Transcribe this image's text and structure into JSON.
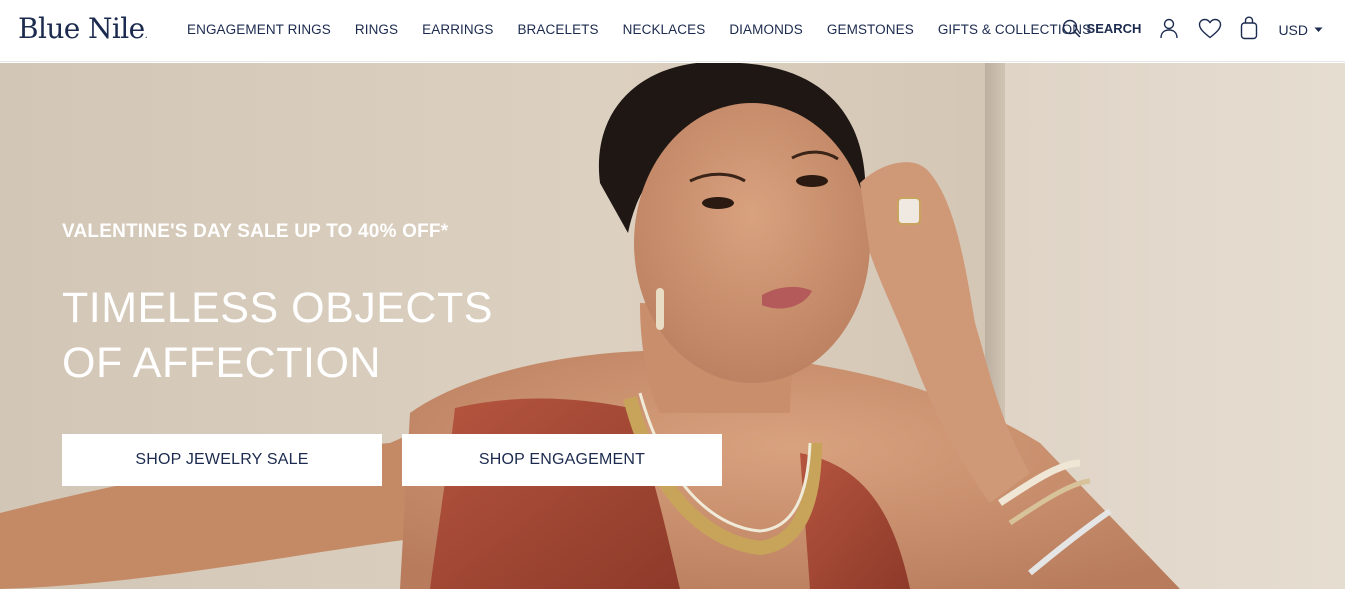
{
  "brand": {
    "logo_text": "Blue Nile",
    "logo_dot": "."
  },
  "nav": {
    "items": [
      {
        "label": "ENGAGEMENT RINGS"
      },
      {
        "label": "RINGS"
      },
      {
        "label": "EARRINGS"
      },
      {
        "label": "BRACELETS"
      },
      {
        "label": "NECKLACES"
      },
      {
        "label": "DIAMONDS"
      },
      {
        "label": "GEMSTONES"
      },
      {
        "label": "GIFTS & COLLECTIONS"
      }
    ]
  },
  "tools": {
    "search_label": "SEARCH",
    "search_icon": "search-icon",
    "account_icon": "person-icon",
    "wishlist_icon": "heart-icon",
    "bag_icon": "bag-icon",
    "currency": "USD",
    "currency_icon": "caret-down-icon"
  },
  "hero": {
    "promo": "VALENTINE'S DAY SALE UP TO 40% OFF*",
    "headline_line1": "TIMELESS OBJECTS",
    "headline_line2": "OF AFFECTION",
    "cta_primary": "SHOP JEWELRY SALE",
    "cta_secondary": "SHOP ENGAGEMENT"
  },
  "colors": {
    "brand_navy": "#1b2a4e",
    "hero_background": "#d9cdbd",
    "button_background": "#ffffff"
  }
}
